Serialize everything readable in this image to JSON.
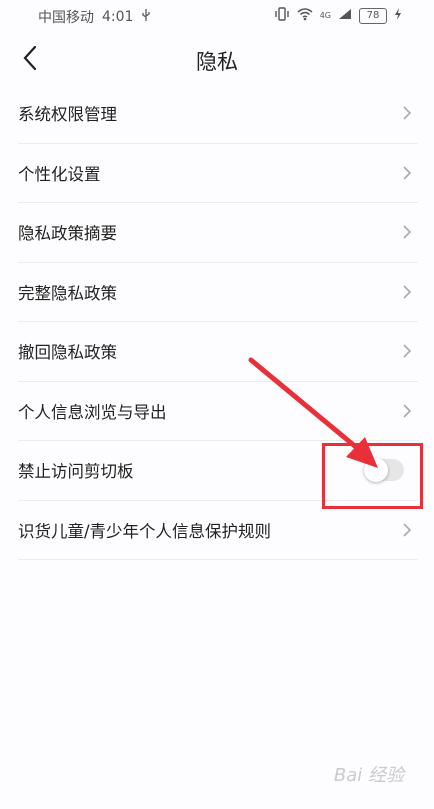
{
  "status_bar": {
    "carrier": "中国移动",
    "time": "4:01",
    "network": "4G",
    "battery": "78"
  },
  "header": {
    "title": "隐私"
  },
  "items": [
    {
      "label": "系统权限管理",
      "type": "link"
    },
    {
      "label": "个性化设置",
      "type": "link"
    },
    {
      "label": "隐私政策摘要",
      "type": "link"
    },
    {
      "label": "完整隐私政策",
      "type": "link"
    },
    {
      "label": "撤回隐私政策",
      "type": "link"
    },
    {
      "label": "个人信息浏览与导出",
      "type": "link"
    },
    {
      "label": "禁止访问剪切板",
      "type": "toggle",
      "toggle_state": "off"
    },
    {
      "label": "识货儿童/青少年个人信息保护规则",
      "type": "link"
    }
  ],
  "annotation": {
    "color": "#e8303a"
  },
  "watermark": "Bai 经验"
}
